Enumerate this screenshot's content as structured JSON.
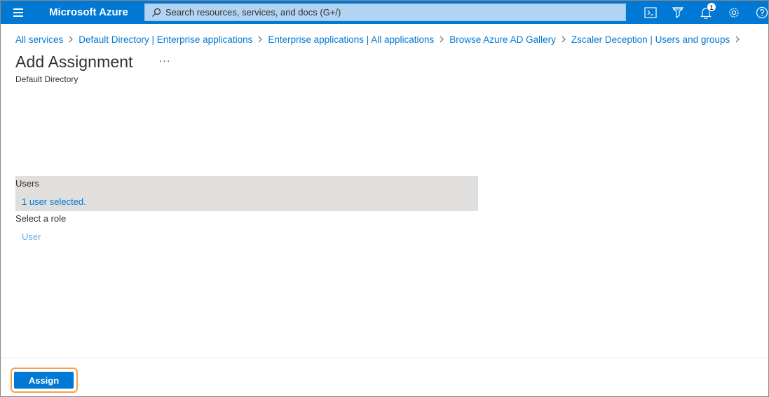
{
  "header": {
    "brand": "Microsoft Azure",
    "search_placeholder": "Search resources, services, and docs (G+/)",
    "notification_count": "1",
    "icons": [
      "menu-icon",
      "search-icon",
      "cloud-shell-icon",
      "directory-filter-icon",
      "notifications-icon",
      "settings-icon",
      "help-icon"
    ]
  },
  "breadcrumb": [
    "All services",
    "Default Directory | Enterprise applications",
    "Enterprise applications | All applications",
    "Browse Azure AD Gallery",
    "Zscaler Deception | Users and groups"
  ],
  "page": {
    "title": "Add Assignment",
    "more": "···",
    "subtitle": "Default Directory"
  },
  "users": {
    "label": "Users",
    "selected_text": "1 user selected."
  },
  "role": {
    "label": "Select a role",
    "value": "User"
  },
  "footer": {
    "assign_label": "Assign"
  },
  "colors": {
    "azure_blue": "#0078d4",
    "search_bg": "#b1d4f2",
    "section_bg": "#e1dfdd",
    "highlight": "#f5a04a",
    "link_light": "#69afe5"
  }
}
